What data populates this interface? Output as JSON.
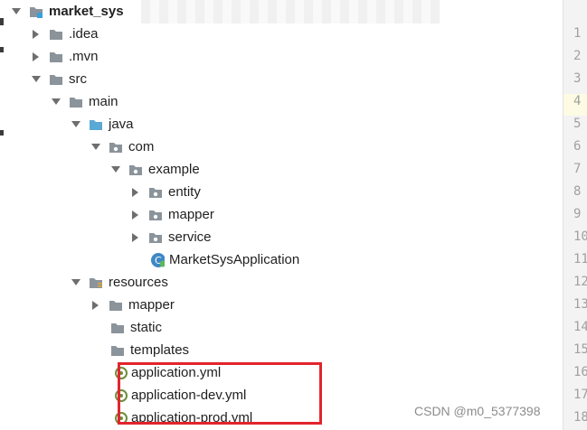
{
  "project": {
    "root": "market_sys",
    "items": {
      "idea": ".idea",
      "mvn": ".mvn",
      "src": "src",
      "main": "main",
      "java": "java",
      "com": "com",
      "example": "example",
      "entity": "entity",
      "mapper_pkg": "mapper",
      "service": "service",
      "app_class": "MarketSysApplication",
      "resources": "resources",
      "mapper_res": "mapper",
      "static": "static",
      "templates": "templates",
      "app_yml": "application.yml",
      "app_dev_yml": "application-dev.yml",
      "app_prod_yml": "application-prod.yml"
    }
  },
  "gutter": {
    "lines": [
      "1",
      "2",
      "3",
      "4",
      "5",
      "6",
      "7",
      "8",
      "9",
      "10",
      "11",
      "12",
      "13",
      "14",
      "15",
      "16",
      "17",
      "18"
    ]
  },
  "watermark": "CSDN @m0_5377398",
  "colors": {
    "highlight": "#e2252d",
    "folder": "#8b939b",
    "source_folder": "#5aa8d6",
    "current_line": "#fdfbe3"
  }
}
